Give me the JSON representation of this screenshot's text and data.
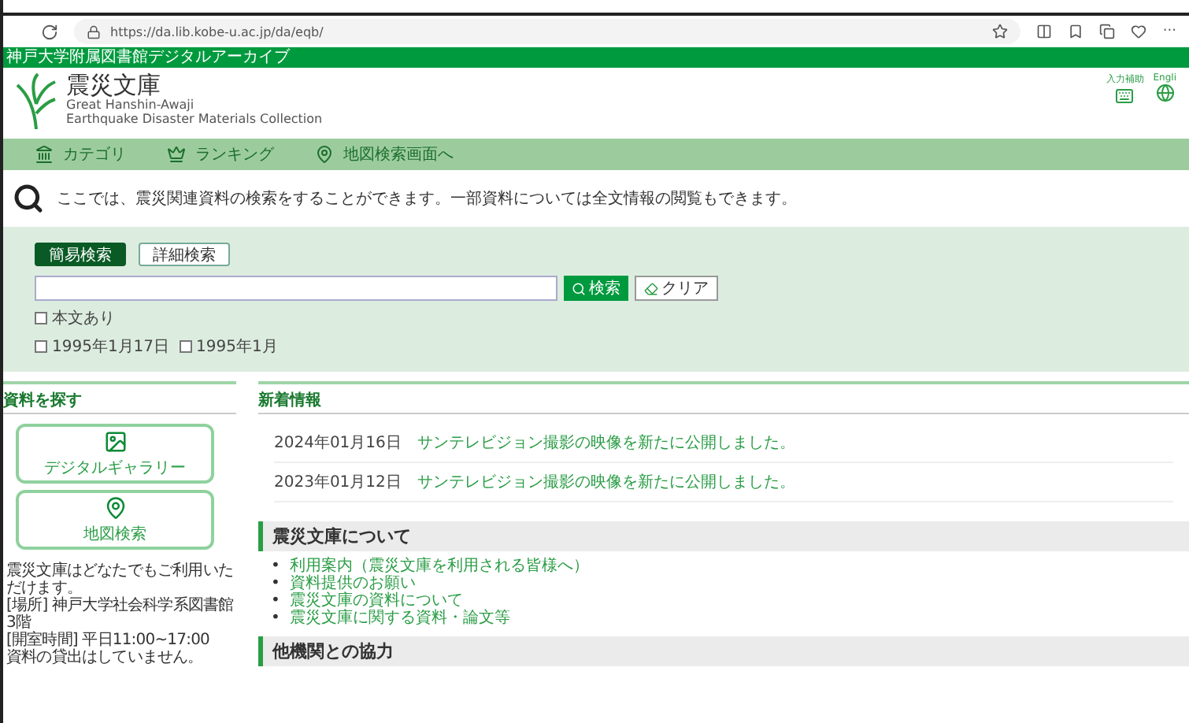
{
  "browser": {
    "url": "https://da.lib.kobe-u.ac.jp/da/eqb/",
    "more": "···"
  },
  "site_bar": {
    "title": "神戸大学附属図書館デジタルアーカイブ"
  },
  "header": {
    "title": "震災文庫",
    "subtitle_lines": [
      "Great Hanshin-Awaji",
      "Earthquake Disaster Materials Collection"
    ],
    "tools": [
      {
        "kind": "input",
        "label": "入力補助"
      },
      {
        "kind": "globe",
        "label": "Engli"
      }
    ]
  },
  "nav": [
    {
      "kind": "category",
      "label": "カテゴリ"
    },
    {
      "kind": "ranking",
      "label": "ランキング"
    },
    {
      "kind": "map",
      "label": "地図検索画面へ"
    }
  ],
  "intro": "ここでは、震災関連資料の検索をすることができます。一部資料については全文情報の閲覧もできます。",
  "search": {
    "tabs": [
      {
        "label": "簡易検索",
        "selected": true
      },
      {
        "label": "詳細検索",
        "selected": false
      }
    ],
    "search_button": "検索",
    "clear_button": "クリア",
    "filters": [
      {
        "label": "本文あり",
        "checked": false
      }
    ],
    "dates": [
      {
        "label": "1995年1月17日",
        "checked": false
      },
      {
        "label": "1995年1月",
        "checked": false
      }
    ]
  },
  "sidebar": {
    "title": "資料を探す",
    "cards": [
      {
        "kind": "gallery",
        "label": "デジタルギャラリー"
      },
      {
        "kind": "map",
        "label": "地図検索"
      }
    ],
    "notes": [
      "震災文庫はどなたでもご利用いただけます。",
      "[場所] 神戸大学社会科学系図書館 3階",
      "[開室時間] 平日11:00~17:00",
      "資料の貸出はしていません。"
    ]
  },
  "news": {
    "title": "新着情報",
    "items": [
      {
        "date": "2024年01月16日",
        "text": "サンテレビジョン撮影の映像を新たに公開しました。"
      },
      {
        "date": "2023年01月12日",
        "text": "サンテレビジョン撮影の映像を新たに公開しました。"
      }
    ]
  },
  "sections": [
    {
      "title": "震災文庫について",
      "links": [
        {
          "bullet": "•",
          "text": "利用案内（震災文庫を利用される皆様へ）"
        },
        {
          "bullet": "•",
          "text": "資料提供のお願い"
        },
        {
          "bullet": "•",
          "text": "震災文庫の資料について"
        },
        {
          "bullet": "•",
          "text": "震災文庫に関する資料・論文等"
        }
      ]
    },
    {
      "title": "他機関との協力"
    }
  ]
}
